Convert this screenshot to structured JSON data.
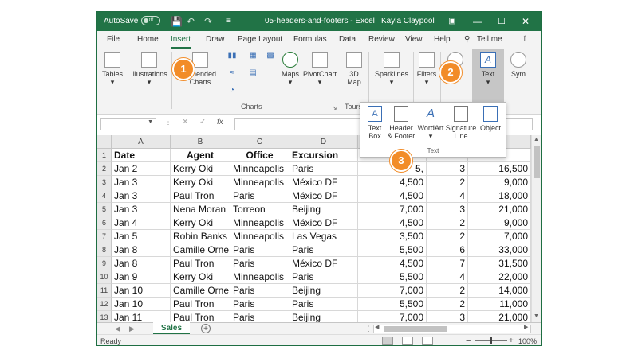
{
  "titlebar": {
    "autosave_label": "AutoSave",
    "toggle_state": "Off",
    "filename": "05-headers-and-footers - Excel",
    "user": "Kayla Claypool"
  },
  "menu": [
    "File",
    "Home",
    "Insert",
    "Draw",
    "Page Layout",
    "Formulas",
    "Data",
    "Review",
    "View",
    "Help",
    "Tell me"
  ],
  "ribbon": {
    "tables": "Tables",
    "illustrations": "Illustrations",
    "recommended_charts_1": "mmended",
    "recommended_charts_2": "Charts",
    "maps": "Maps",
    "pivotchart": "PivotChart",
    "map3d_1": "3D",
    "map3d_2": "Map",
    "sparklines": "Sparklines",
    "filters": "Filters",
    "links_arrow": "",
    "text": "Text",
    "symbols": "Sym",
    "group_charts": "Charts",
    "group_tours": "Tours"
  },
  "text_dropdown": {
    "textbox_1": "Text",
    "textbox_2": "Box",
    "header_footer_1": "Header",
    "header_footer_2": "& Footer",
    "wordart": "WordArt",
    "signature_1": "Signature",
    "signature_2": "Line",
    "object": "Object",
    "group_label": "Text"
  },
  "callouts": [
    "1",
    "2",
    "3"
  ],
  "formula_bar": {
    "fx": "fx"
  },
  "columns": [
    "A",
    "B",
    "C",
    "D"
  ],
  "header_row": {
    "date": "Date",
    "agent": "Agent",
    "office": "Office",
    "excursion": "Excursion",
    "last": "al"
  },
  "rows": [
    {
      "n": "2",
      "date": "Jan 2",
      "agent": "Kerry Oki",
      "office": "Minneapolis",
      "excursion": "Paris",
      "price": "5,",
      "qty": "3",
      "total": "16,500"
    },
    {
      "n": "3",
      "date": "Jan 3",
      "agent": "Kerry Oki",
      "office": "Minneapolis",
      "excursion": "México DF",
      "price": "4,500",
      "qty": "2",
      "total": "9,000"
    },
    {
      "n": "4",
      "date": "Jan 3",
      "agent": "Paul Tron",
      "office": "Paris",
      "excursion": "México DF",
      "price": "4,500",
      "qty": "4",
      "total": "18,000"
    },
    {
      "n": "5",
      "date": "Jan 3",
      "agent": "Nena Moran",
      "office": "Torreon",
      "excursion": "Beijing",
      "price": "7,000",
      "qty": "3",
      "total": "21,000"
    },
    {
      "n": "6",
      "date": "Jan 4",
      "agent": "Kerry Oki",
      "office": "Minneapolis",
      "excursion": "México DF",
      "price": "4,500",
      "qty": "2",
      "total": "9,000"
    },
    {
      "n": "7",
      "date": "Jan 5",
      "agent": "Robin Banks",
      "office": "Minneapolis",
      "excursion": "Las Vegas",
      "price": "3,500",
      "qty": "2",
      "total": "7,000"
    },
    {
      "n": "8",
      "date": "Jan 8",
      "agent": "Camille Orne",
      "office": "Paris",
      "excursion": "Paris",
      "price": "5,500",
      "qty": "6",
      "total": "33,000"
    },
    {
      "n": "9",
      "date": "Jan 8",
      "agent": "Paul Tron",
      "office": "Paris",
      "excursion": "México DF",
      "price": "4,500",
      "qty": "7",
      "total": "31,500"
    },
    {
      "n": "10",
      "date": "Jan 9",
      "agent": "Kerry Oki",
      "office": "Minneapolis",
      "excursion": "Paris",
      "price": "5,500",
      "qty": "4",
      "total": "22,000"
    },
    {
      "n": "11",
      "date": "Jan 10",
      "agent": "Camille Orne",
      "office": "Paris",
      "excursion": "Beijing",
      "price": "7,000",
      "qty": "2",
      "total": "14,000"
    },
    {
      "n": "12",
      "date": "Jan 10",
      "agent": "Paul Tron",
      "office": "Paris",
      "excursion": "Paris",
      "price": "5,500",
      "qty": "2",
      "total": "11,000"
    },
    {
      "n": "13",
      "date": "Jan 11",
      "agent": "Paul Tron",
      "office": "Paris",
      "excursion": "Beijing",
      "price": "7,000",
      "qty": "3",
      "total": "21,000"
    }
  ],
  "row1": "1",
  "sheet": {
    "tab": "Sales"
  },
  "status": {
    "ready": "Ready",
    "zoom": "100%"
  },
  "colors": {
    "excel_green": "#217346",
    "callout_orange": "#f28c28"
  }
}
